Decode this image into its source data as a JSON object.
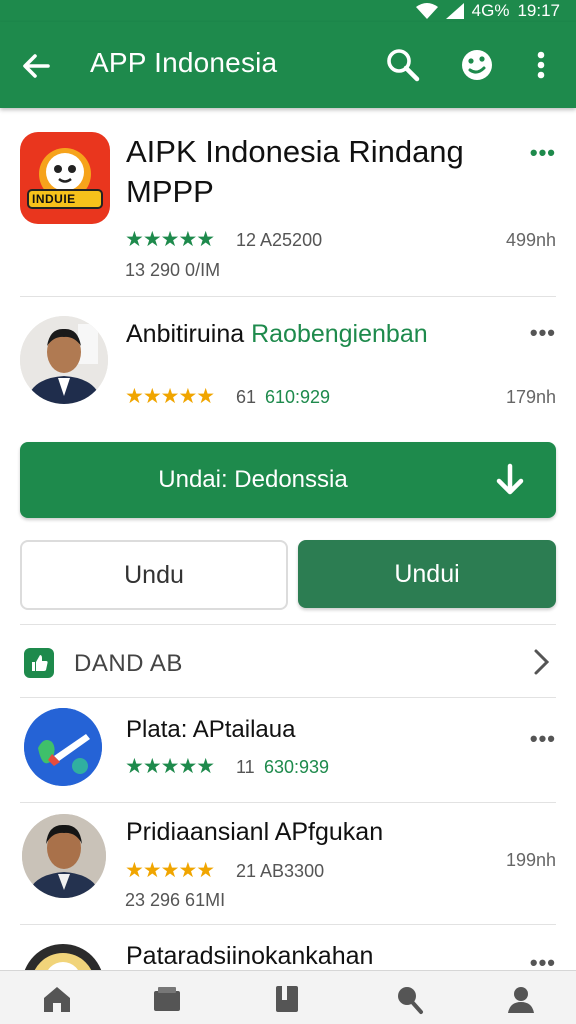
{
  "status_bar": {
    "signal": "4G%",
    "time": "19:17"
  },
  "app_bar": {
    "title": "APP Indonesia"
  },
  "apps": [
    {
      "name_line1": "AIPK Indonesia Rindang",
      "name_line2": "MPPP",
      "stars": "★★★★★",
      "rating_text": "12  A25200",
      "downloads": "13 290 0/IM",
      "size": "499nh",
      "icon_text": "INDUIE"
    },
    {
      "name_black": "Anbitiruina ",
      "name_green": "Raobengienban",
      "stars": "★★★★★",
      "rating_text": "61",
      "rating_green": "610:929",
      "size": "179nh"
    }
  ],
  "buttons": {
    "main_label": "Undai: Dedonssia",
    "left_label": "Undu",
    "right_label": "Undui"
  },
  "section": {
    "label": "DAND AB"
  },
  "list": [
    {
      "name": "Plata: APtailaua",
      "stars": "★★★★★",
      "rating_text": "11",
      "rating_green": "630:939"
    },
    {
      "name": "Pridiaansianl APfgukan",
      "stars": "★★★★★",
      "rating_text": "21  AB3300",
      "downloads": "23 296 61MI",
      "size": "199nh"
    },
    {
      "name": "Pataradsiinokankahan"
    }
  ]
}
